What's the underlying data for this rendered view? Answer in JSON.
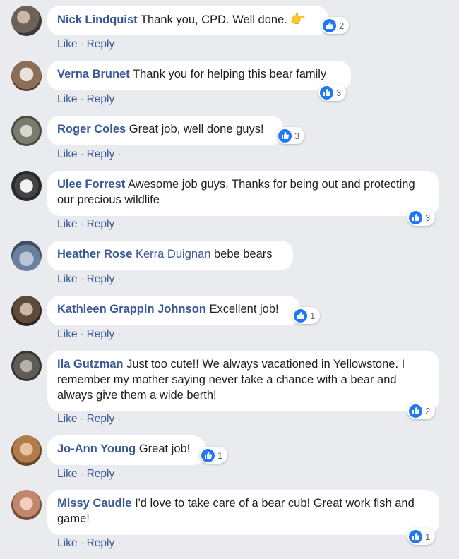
{
  "actions": {
    "like": "Like",
    "reply": "Reply",
    "separator": "·"
  },
  "icons": {
    "like_reaction": "thumbs-up-icon",
    "emoji": "pointing-hand-icon"
  },
  "colors": {
    "author": "#385898",
    "like_blue": "#2078f4",
    "background": "#e9ebee"
  },
  "comments": [
    {
      "author": "Nick Lindquist",
      "text": "Thank you, CPD. Well done.",
      "emoji": "👉",
      "likes": "2"
    },
    {
      "author": "Verna Brunet",
      "text": "Thank you for helping this bear family",
      "likes": "3"
    },
    {
      "author": "Roger Coles",
      "text": "Great job, well done guys!",
      "likes": "3"
    },
    {
      "author": "Ulee Forrest",
      "text": "Awesome job guys. Thanks for being out and protecting our precious wildlife",
      "likes": "3"
    },
    {
      "author": "Heather Rose",
      "mention": "Kerra Duignan",
      "text": "bebe bears"
    },
    {
      "author": "Kathleen Grappin Johnson",
      "text": "Excellent job!",
      "likes": "1"
    },
    {
      "author": "Ila Gutzman",
      "text": "Just too cute!! We always vacationed in Yellowstone. I remember my mother saying never take a chance with a bear and always give them a wide berth!",
      "likes": "2"
    },
    {
      "author": "Jo-Ann Young",
      "text": "Great job!",
      "likes": "1"
    },
    {
      "author": "Missy Caudle",
      "text": "I'd love to take care of a bear cub! Great work fish and game!",
      "likes": "1"
    }
  ]
}
